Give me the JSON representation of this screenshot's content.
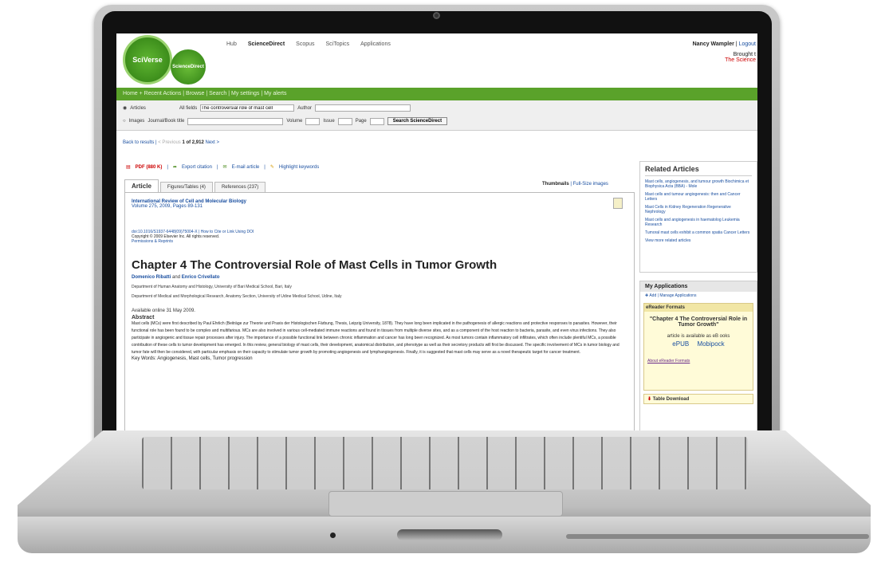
{
  "topnav": {
    "items": [
      "Hub",
      "ScienceDirect",
      "Scopus",
      "SciTopics",
      "Applications"
    ],
    "active_index": 1
  },
  "brand": {
    "sciverse": "SciVerse",
    "sciencedirect": "ScienceDirect"
  },
  "user": {
    "name": "Nancy Wampler",
    "logout": "Logout",
    "brought": "Brought t",
    "institution": "The Science"
  },
  "greenbar": {
    "text": "Home + Recent Actions  |  Browse  |  Search  |  My settings  |  My alerts"
  },
  "search": {
    "articles_label": "Articles",
    "images_label": "Images",
    "allfields_label": "All fields",
    "allfields_value": "The controversial role of mast cell",
    "author_label": "Author",
    "journal_label": "Journal/Book title",
    "volume_label": "Volume",
    "issue_label": "Issue",
    "page_label": "Page",
    "button": "Search ScienceDirect"
  },
  "results_nav": {
    "back": "Back to results",
    "sep": "|",
    "prev": "< Previous",
    "count": "1 of 2,912",
    "next": "Next >"
  },
  "toolbar": {
    "pdf": "PDF (880 K)",
    "export": "Export citation",
    "email": "E-mail article",
    "highlight": "Highlight keywords"
  },
  "tabs": [
    "Article",
    "Figures/Tables (4)",
    "References (237)"
  ],
  "thumbs": {
    "label": "Thumbnails",
    "sep": "|",
    "full": "Full-Size images"
  },
  "article": {
    "journal": "International Review of Cell and Molecular Biology",
    "volume": "Volume 275, 2009, Pages 89-131",
    "doi": "doi:10.1016/S1937-6448(09)75004-X | How to Cite or Link Using DOI",
    "copyright": "Copyright © 2009 Elsevier Inc. All rights reserved.",
    "permissions": "Permissions & Reprints",
    "title": "Chapter 4 The Controversial Role of Mast Cells in Tumor Growth",
    "author1": "Domenico Ribatti",
    "and": "and",
    "author2": "Enrico Crivellato",
    "aff1": "Department of Human Anatomy and Histology, University of Bari Medical School, Bari, Italy",
    "aff2": "Department of Medical and Morphological Research, Anatomy Section, University of Udine Medical School, Udine, Italy",
    "available": "Available online 31 May 2009.",
    "abstract_heading": "Abstract",
    "abstract": "Mast cells (MCs) were first described by Paul Ehrlich (Beiträge zur Theorie und Praxis der Histologischen Färbung, Thesis, Leipzig University, 1878). They have long been implicated in the pathogenesis of allergic reactions and protective responses to parasites. However, their functional role has been found to be complex and multifarious. MCs are also involved in various cell-mediated immune reactions and found in tissues from multiple diverse sites, and as a component of the host reaction to bacteria, parasite, and even virus infections. They also participate in angiogenic and tissue repair processes after injury. The importance of a possible functional link between chronic inflammation and cancer has long been recognized. As most tumors contain inflammatory cell infiltrates, which often include plentiful MCs, a possible contribution of these cells to tumor development has emerged. In this review, general biology of mast cells, their development, anatomical distribution, and phenotype as well as their secretory products will first be discussed. The specific involvement of MCs in tumor biology and tumor fate will then be considered, with particular emphasis on their capacity to stimulate tumor growth by promoting angiogenesis and lymphangiogenesis. Finally, it is suggested that mast cells may serve as a novel therapeutic target for cancer treatment.",
    "keywords": "Key Words: Angiogenesis, Mast cells, Tumor progression"
  },
  "sidebar": {
    "related_title": "Related Articles",
    "related": [
      "Mast cells, angiogenesis, and tumour growth  Biochimica et Biophysica Acta (BBA) - Mole",
      "Mast cells and tumour angiogenesis: then and  Cancer Letters",
      "Mast Cells in Kidney Regeneration  Regenerative Nephrology",
      "Mast cells and angiogenesis in haematolog  Leukemia Research",
      "Tumoral mast cells exhibit a common spatia  Cancer Letters"
    ],
    "view_more": "View more related articles",
    "myapps_title": "My Applications",
    "add": "Add",
    "manage": "Manage Applications",
    "ereader_title": "eReader Formats",
    "ereader_chapter": "\"Chapter 4 The Controversial Role in Tumor Growth\"",
    "ereader_available": "article is available as eB ooks",
    "epub": "ePUB",
    "mobipocket": "Mobipock",
    "about": "About eReader Formats",
    "table_download": "Table Download"
  }
}
